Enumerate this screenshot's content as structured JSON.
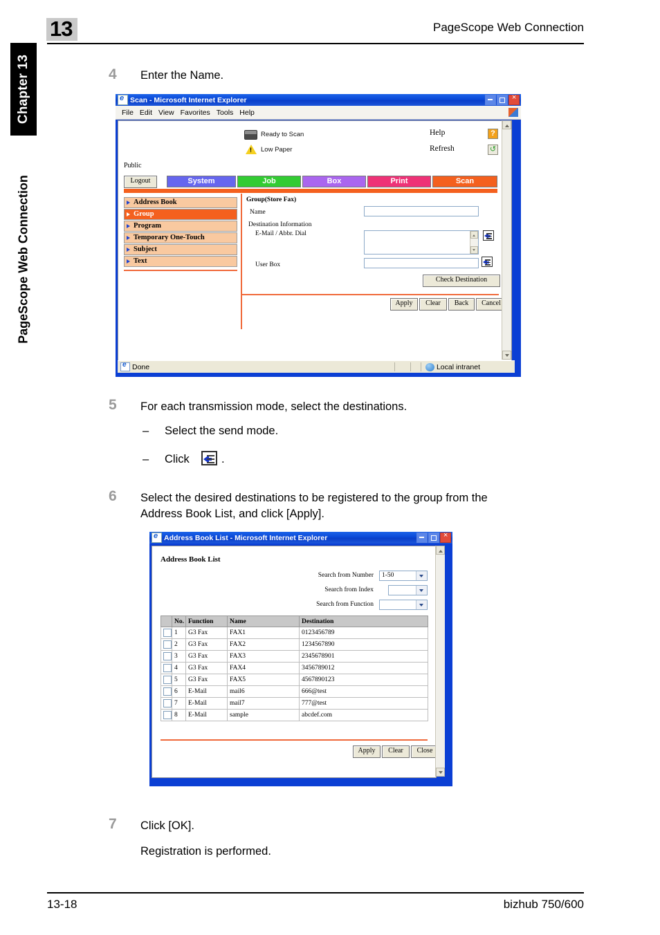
{
  "page": {
    "chapter_tab": "Chapter 13",
    "side_title": "PageScope Web Connection",
    "header_number": "13",
    "header_title": "PageScope Web Connection",
    "footer_left": "13-18",
    "footer_right": "bizhub 750/600"
  },
  "steps": {
    "s4": {
      "num": "4",
      "text": "Enter the Name."
    },
    "s5": {
      "num": "5",
      "text": "For each transmission mode, select the destinations.",
      "dash": "–",
      "sub1": "Select the send mode.",
      "sub2_pre": "Click",
      "sub2_post": "."
    },
    "s6": {
      "num": "6",
      "line1": "Select the desired destinations to be registered to the group from the",
      "line2": "Address Book List, and click [Apply]."
    },
    "s7": {
      "num": "7",
      "text": "Click [OK].",
      "note": "Registration is performed."
    }
  },
  "scan_window": {
    "title": "Scan - Microsoft Internet Explorer",
    "menu": [
      "File",
      "Edit",
      "View",
      "Favorites",
      "Tools",
      "Help"
    ],
    "status_items": [
      {
        "label": "Ready to Scan",
        "icon": "printer-icon"
      },
      {
        "label": "Low Paper",
        "icon": "warning-icon"
      }
    ],
    "help_label": "Help",
    "refresh_label": "Refresh",
    "help_icon": "question-mark-icon",
    "refresh_icon": "refresh-icon",
    "user_label": "Public",
    "logout_label": "Logout",
    "tabs": [
      {
        "label": "System",
        "color": "#6666ee"
      },
      {
        "label": "Job",
        "color": "#33cc33"
      },
      {
        "label": "Box",
        "color": "#aa66ee"
      },
      {
        "label": "Print",
        "color": "#ee3377"
      },
      {
        "label": "Scan",
        "color": "#f4601e"
      }
    ],
    "nav": [
      {
        "label": "Address Book",
        "selected": false
      },
      {
        "label": "Group",
        "selected": true
      },
      {
        "label": "Program",
        "selected": false
      },
      {
        "label": "Temporary One-Touch",
        "selected": false
      },
      {
        "label": "Subject",
        "selected": false
      },
      {
        "label": "Text",
        "selected": false
      }
    ],
    "form": {
      "heading": "Group(Store Fax)",
      "name_label": "Name",
      "name_value": "",
      "dest_info_label": "Destination Information",
      "email_label": "E-Mail / Abbr. Dial",
      "email_value": "",
      "userbox_label": "User Box",
      "userbox_value": "",
      "check_destination": "Check Destination",
      "buttons": [
        "Apply",
        "Clear",
        "Back",
        "Cancel"
      ]
    },
    "statusbar": {
      "text": "Done",
      "zone": "Local intranet"
    }
  },
  "addressbook_window": {
    "title": "Address Book List - Microsoft Internet Explorer",
    "heading": "Address Book List",
    "filters": [
      {
        "label": "Search from Number",
        "value": "1-50"
      },
      {
        "label": "Search from Index",
        "value": ""
      },
      {
        "label": "Search from Function",
        "value": ""
      }
    ],
    "columns": [
      "",
      "No.",
      "Function",
      "Name",
      "Destination"
    ],
    "rows": [
      {
        "no": "1",
        "function": "G3 Fax",
        "name": "FAX1",
        "destination": "0123456789"
      },
      {
        "no": "2",
        "function": "G3 Fax",
        "name": "FAX2",
        "destination": "1234567890"
      },
      {
        "no": "3",
        "function": "G3 Fax",
        "name": "FAX3",
        "destination": "2345678901"
      },
      {
        "no": "4",
        "function": "G3 Fax",
        "name": "FAX4",
        "destination": "3456789012"
      },
      {
        "no": "5",
        "function": "G3 Fax",
        "name": "FAX5",
        "destination": "4567890123"
      },
      {
        "no": "6",
        "function": "E-Mail",
        "name": "mail6",
        "destination": "666@test"
      },
      {
        "no": "7",
        "function": "E-Mail",
        "name": "mail7",
        "destination": "777@test"
      },
      {
        "no": "8",
        "function": "E-Mail",
        "name": "sample",
        "destination": "abcdef.com"
      }
    ],
    "buttons": [
      "Apply",
      "Clear",
      "Close"
    ]
  }
}
